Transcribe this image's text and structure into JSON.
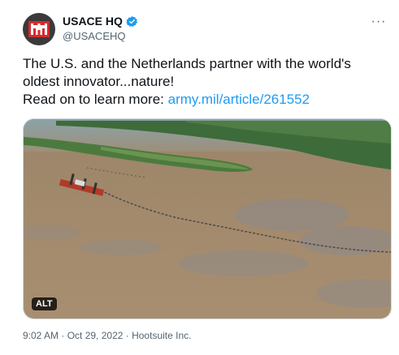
{
  "author": {
    "display_name": "USACE HQ",
    "handle": "@USACEHQ",
    "verified_icon": "verified-badge-icon",
    "avatar_icon": "usace-castle-logo"
  },
  "more_icon": "more-options-icon",
  "tweet": {
    "line1": "The U.S. and the Netherlands partner with the world's",
    "line2": "oldest innovator...nature!",
    "line3_prefix": "Read on to learn more: ",
    "link_text": "army.mil/article/261552"
  },
  "media": {
    "alt_label": "ALT",
    "description_icon": "aerial-river-dredging-photo"
  },
  "meta": {
    "time": "9:02 AM",
    "sep1": " · ",
    "date": "Oct 29, 2022",
    "sep2": " · ",
    "source": "Hootsuite Inc."
  },
  "colors": {
    "link": "#1d9bf0",
    "verified": "#1d9bf0",
    "secondary_text": "#536471"
  }
}
